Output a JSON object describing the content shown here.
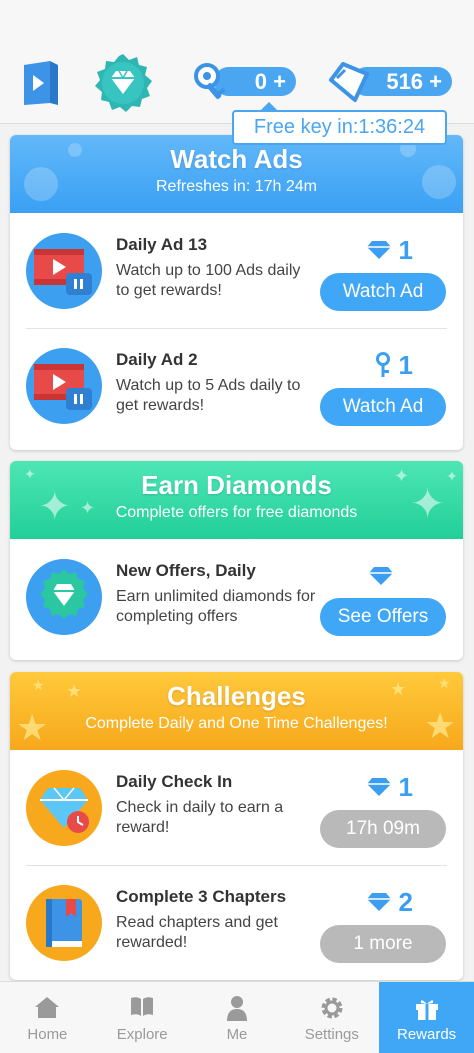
{
  "header": {
    "keys_count": "0 +",
    "diamonds_count": "516 +",
    "free_key_tooltip": "Free key in:1:36:24"
  },
  "icons": {
    "book": "book-play-icon",
    "premium": "diamond-badge-icon",
    "key": "key-icon",
    "diamond": "diamond-icon"
  },
  "colors": {
    "accent_blue": "#3fa7f5",
    "watch_ads_header": "#3aa0f3",
    "earn_diamonds_header": "#22cf98",
    "challenges_header": "#f7a81c",
    "disabled_button": "#b9b9b9"
  },
  "watch_ads": {
    "title": "Watch Ads",
    "subtitle": "Refreshes in: 17h 24m",
    "items": [
      {
        "title": "Daily Ad 13",
        "description": "Watch up to 100 Ads daily to get rewards!",
        "reward_type": "diamond",
        "reward_count": "1",
        "button": "Watch Ad"
      },
      {
        "title": "Daily Ad 2",
        "description": "Watch up to 5 Ads daily to get rewards!",
        "reward_type": "key",
        "reward_count": "1",
        "button": "Watch Ad"
      }
    ]
  },
  "earn_diamonds": {
    "title": "Earn Diamonds",
    "subtitle": "Complete offers for free diamonds",
    "items": [
      {
        "title": "New Offers, Daily",
        "description": "Earn unlimited diamonds for completing offers",
        "reward_type": "diamond",
        "reward_count": "",
        "button": "See Offers"
      }
    ]
  },
  "challenges": {
    "title": "Challenges",
    "subtitle": "Complete Daily and One Time Challenges!",
    "items": [
      {
        "title": "Daily Check In",
        "description": "Check in daily to earn a reward!",
        "reward_type": "diamond",
        "reward_count": "1",
        "button": "17h 09m"
      },
      {
        "title": "Complete 3 Chapters",
        "description": "Read chapters and get rewarded!",
        "reward_type": "diamond",
        "reward_count": "2",
        "button": "1 more"
      }
    ]
  },
  "nav": {
    "items": [
      {
        "label": "Home",
        "icon": "home-icon"
      },
      {
        "label": "Explore",
        "icon": "open-book-icon"
      },
      {
        "label": "Me",
        "icon": "person-icon"
      },
      {
        "label": "Settings",
        "icon": "gear-icon"
      },
      {
        "label": "Rewards",
        "icon": "gift-icon"
      }
    ],
    "active": "Rewards"
  }
}
